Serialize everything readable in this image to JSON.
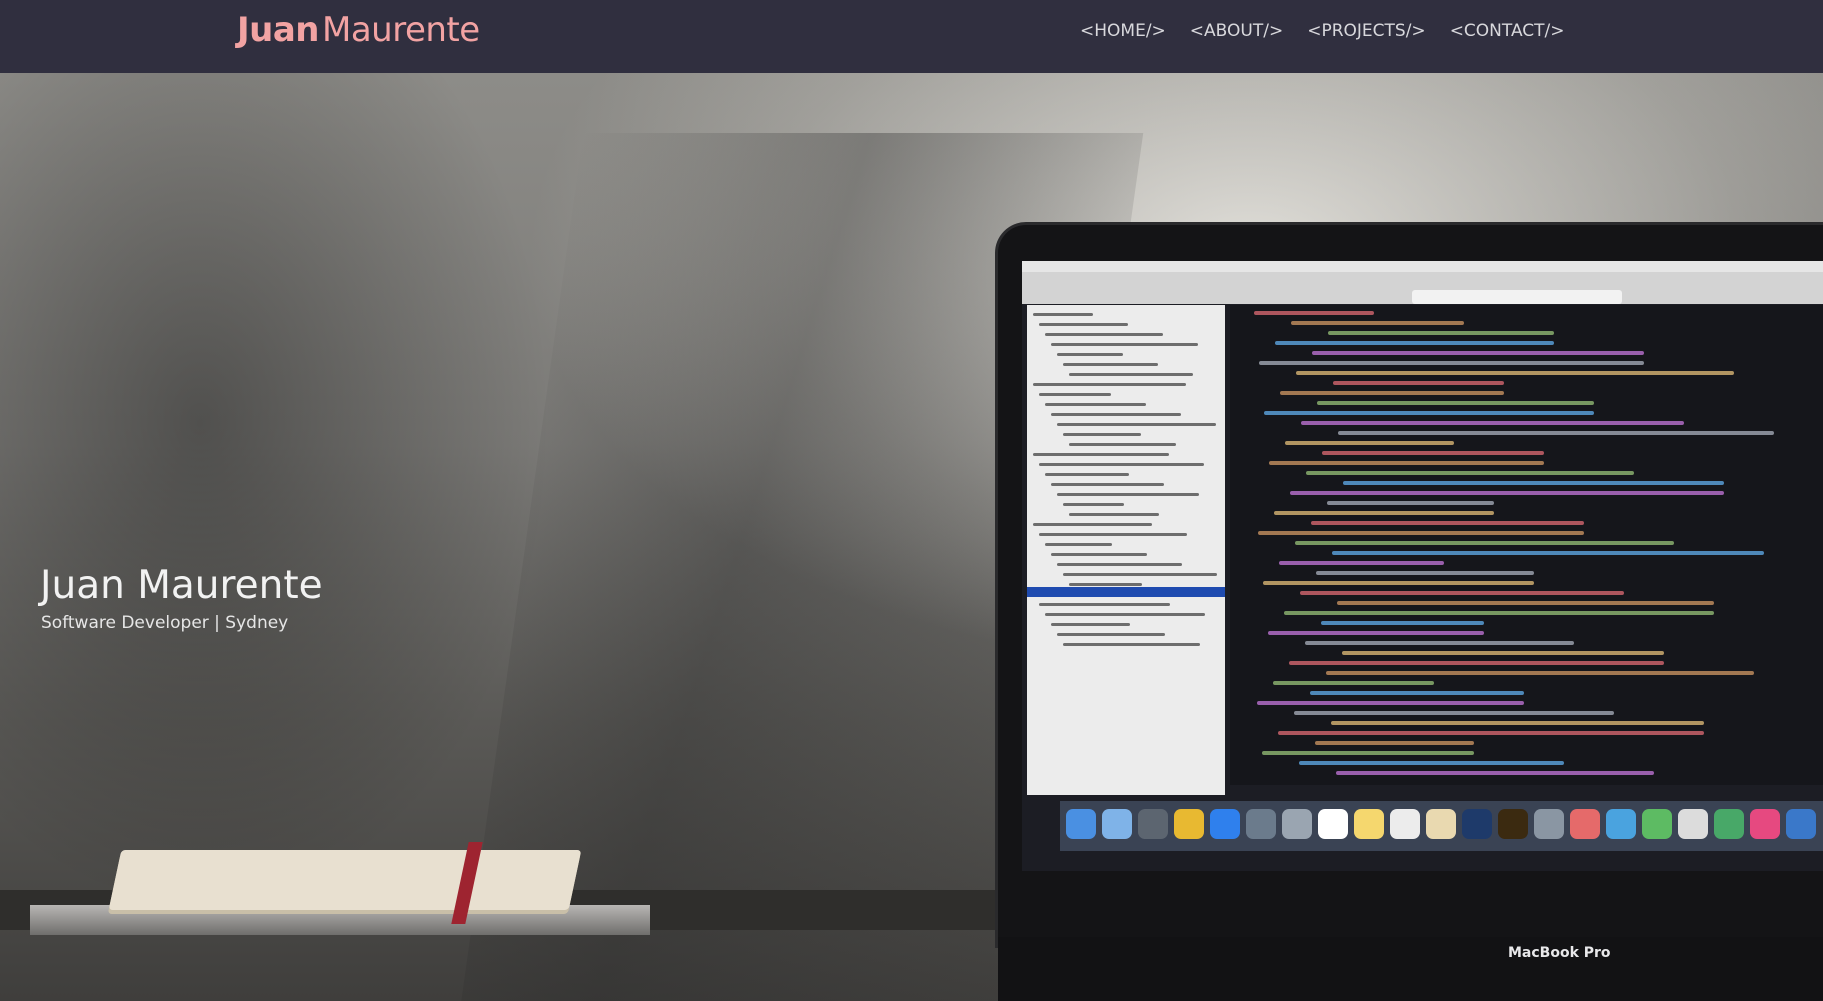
{
  "navbar": {
    "brand_first": "Juan",
    "brand_last": "Maurente",
    "links": [
      {
        "label": "<HOME/>"
      },
      {
        "label": "<ABOUT/>"
      },
      {
        "label": "<PROJECTS/>"
      },
      {
        "label": "<CONTACT/>"
      }
    ]
  },
  "hero": {
    "name": "Juan Maurente",
    "subtitle": "Software Developer | Sydney",
    "laptop_label": "MacBook Pro"
  },
  "colors": {
    "navbar_bg": "#302f3f",
    "brand": "#f2a3a3",
    "nav_text": "#d8d8dc"
  }
}
